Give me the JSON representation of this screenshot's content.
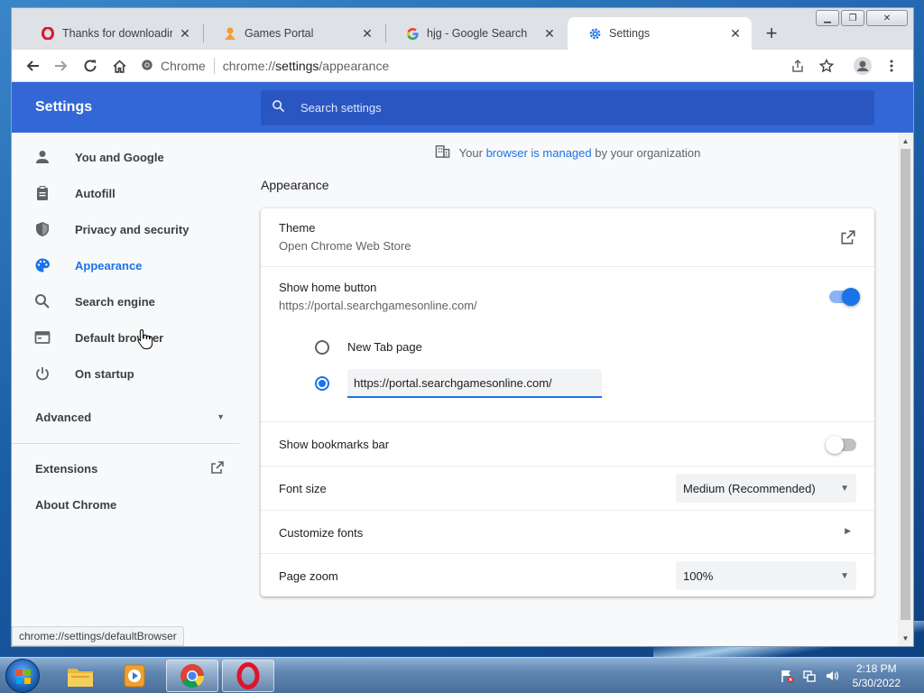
{
  "browser": {
    "tabs": [
      {
        "title": "Thanks for downloading C",
        "favicon": "opera-icon"
      },
      {
        "title": "Games Portal",
        "favicon": "games-portal-icon"
      },
      {
        "title": "hjg - Google Search",
        "favicon": "google-icon"
      },
      {
        "title": "Settings",
        "favicon": "gear-icon"
      }
    ],
    "omnibox": {
      "label": "Chrome",
      "url_scheme": "chrome://",
      "url_host": "settings",
      "url_path": "/appearance"
    },
    "status_bubble": "chrome://settings/defaultBrowser"
  },
  "settings": {
    "title": "Settings",
    "search_placeholder": "Search settings",
    "sidebar": {
      "items": [
        {
          "label": "You and Google",
          "icon": "person-icon"
        },
        {
          "label": "Autofill",
          "icon": "clipboard-icon"
        },
        {
          "label": "Privacy and security",
          "icon": "shield-icon"
        },
        {
          "label": "Appearance",
          "icon": "palette-icon"
        },
        {
          "label": "Search engine",
          "icon": "search-icon"
        },
        {
          "label": "Default browser",
          "icon": "browser-window-icon"
        },
        {
          "label": "On startup",
          "icon": "power-icon"
        }
      ],
      "advanced": "Advanced",
      "extensions": "Extensions",
      "about": "About Chrome"
    },
    "managed": {
      "prefix": "Your",
      "link": "browser is managed",
      "suffix": "by your organization"
    },
    "section_title": "Appearance",
    "theme": {
      "label": "Theme",
      "sub": "Open Chrome Web Store"
    },
    "home_button": {
      "label": "Show home button",
      "sub": "https://portal.searchgamesonline.com/",
      "enabled": true,
      "option_newtab": "New Tab page",
      "custom_url_value": "https://portal.searchgamesonline.com/"
    },
    "bookmarks_bar": {
      "label": "Show bookmarks bar",
      "enabled": false
    },
    "font_size": {
      "label": "Font size",
      "value": "Medium (Recommended)"
    },
    "customize_fonts": {
      "label": "Customize fonts"
    },
    "page_zoom": {
      "label": "Page zoom",
      "value": "100%"
    }
  },
  "taskbar": {
    "time": "2:18 PM",
    "date": "5/30/2022"
  },
  "colors": {
    "accent": "#1a73e8",
    "header": "#3367d6",
    "opera_red": "#e0132b"
  }
}
